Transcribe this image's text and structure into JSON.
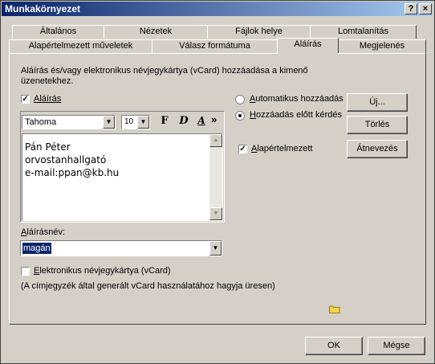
{
  "window": {
    "title": "Munkakörnyezet",
    "help_btn": "?",
    "close_btn": "×"
  },
  "tabs_back": [
    "Általános",
    "Nézetek",
    "Fájlok helye",
    "Lomtalanítás"
  ],
  "tabs_front": [
    "Alapértelmezett műveletek",
    "Válasz formátuma",
    "Aláírás",
    "Megjelenés"
  ],
  "description": "Aláírás és/vagy elektronikus névjegykártya (vCard) hozzáadása a kimenő üzenetekhez.",
  "signature_checkbox": {
    "label": "Aláírás",
    "checked": true
  },
  "toolbar": {
    "font": "Tahoma",
    "size": "10",
    "bold": "F",
    "italic": "D",
    "underline": "A",
    "more": "»"
  },
  "editor_lines": [
    "Pán Péter",
    "orvostanhallgató",
    "e-mail:ppan@kb.hu"
  ],
  "options": {
    "auto_add": "Automatikus hozzáadás",
    "ask_before": "Hozzáadás előtt kérdés",
    "default": "Alapértelmezett"
  },
  "buttons": {
    "new": "Új...",
    "delete": "Törlés",
    "rename": "Átnevezés",
    "ok": "OK",
    "cancel": "Mégse"
  },
  "signature_name": {
    "label": "Aláírásnév:",
    "value": "magán"
  },
  "vcard": {
    "label": "Elektronikus névjegykártya (vCard)",
    "hint": "(A címjegyzék által generált vCard használatához hagyja üresen)"
  },
  "colors": {
    "title_start": "#0a246a",
    "title_end": "#a6caf0",
    "face": "#d4d0c8",
    "selection": "#0a246a"
  }
}
